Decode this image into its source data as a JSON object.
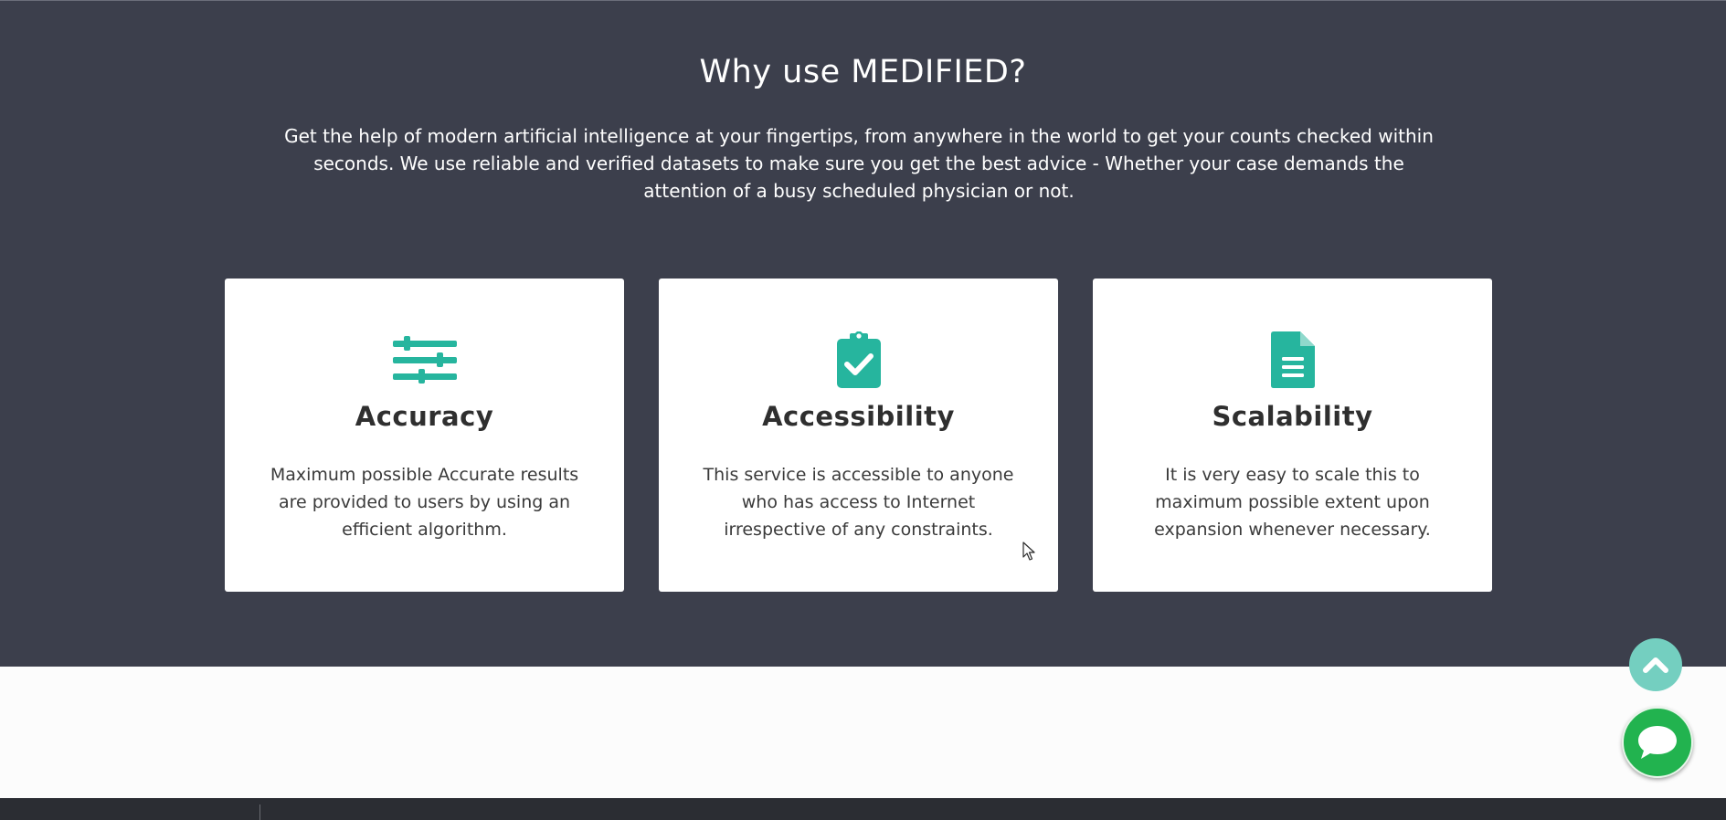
{
  "why_section": {
    "title": "Why use MEDIFIED?",
    "description": "Get the help of modern artificial intelligence at your fingertips, from anywhere in the world to get your counts checked within seconds. We use reliable and verified datasets to make sure you get the best advice - Whether your case demands the attention of a busy scheduled physician or not."
  },
  "cards": [
    {
      "icon": "sliders-icon",
      "title": "Accuracy",
      "text": "Maximum possible Accurate results are provided to users by using an efficient algorithm."
    },
    {
      "icon": "clipboard-check-icon",
      "title": "Accessibility",
      "text": "This service is accessible to anyone who has access to Internet irrespective of any constraints."
    },
    {
      "icon": "file-text-icon",
      "title": "Scalability",
      "text": "It is very easy to scale this to maximum possible extent upon expansion whenever necessary."
    }
  ],
  "colors": {
    "section_bg": "#3c3f4c",
    "accent": "#26b59e",
    "scroll_top": "#74cfc0",
    "chat": "#22b34f"
  },
  "floating": {
    "scroll_top_icon": "chevron-up-icon",
    "chat_icon": "chat-bubble-icon"
  }
}
